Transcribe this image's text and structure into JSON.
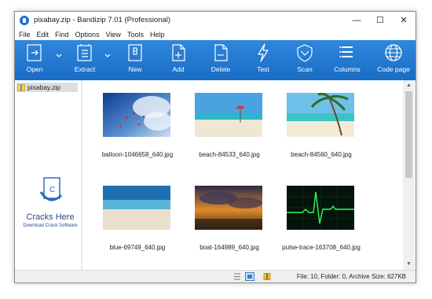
{
  "window": {
    "title": "pixabay.zip - Bandizip 7.01 (Professional)",
    "controls": {
      "minimize": "—",
      "maximize": "☐",
      "close": "✕"
    }
  },
  "menu": [
    "File",
    "Edit",
    "Find",
    "Options",
    "View",
    "Tools",
    "Help"
  ],
  "toolbar": {
    "accent": "#1a6cc4",
    "buttons": [
      {
        "label": "Open",
        "icon": "open-icon",
        "dropdown": true
      },
      {
        "label": "Extract",
        "icon": "extract-icon",
        "dropdown": true
      },
      {
        "label": "New",
        "icon": "new-archive-icon",
        "dropdown": false
      },
      {
        "label": "Add",
        "icon": "add-file-icon",
        "dropdown": false
      },
      {
        "label": "Delete",
        "icon": "delete-file-icon",
        "dropdown": false
      },
      {
        "label": "Test",
        "icon": "test-lightning-icon",
        "dropdown": false
      },
      {
        "label": "Scan",
        "icon": "scan-shield-icon",
        "dropdown": false
      },
      {
        "label": "Columns",
        "icon": "columns-list-icon",
        "dropdown": false
      },
      {
        "label": "Code page",
        "icon": "globe-icon",
        "dropdown": false
      }
    ]
  },
  "sidebar": {
    "root": "pixabay.zip",
    "watermark": {
      "title": "Cracks Here",
      "subtitle": "Download Crack Software"
    }
  },
  "files": [
    {
      "name": "balloon-1046658_640.jpg",
      "thumb": "balloons-sky"
    },
    {
      "name": "beach-84533_640.jpg",
      "thumb": "beach-red-umbrella"
    },
    {
      "name": "beach-84560_640.jpg",
      "thumb": "beach-palm"
    },
    {
      "name": "blue-69749_640.jpg",
      "thumb": "blue-sea-sand"
    },
    {
      "name": "boat-164989_640.jpg",
      "thumb": "sunset-clouds"
    },
    {
      "name": "pulse-trace-163708_640.jpg",
      "thumb": "pulse-trace-green"
    }
  ],
  "statusbar": {
    "text": "File: 10, Folder: 0, Archive Size: 627KB"
  }
}
